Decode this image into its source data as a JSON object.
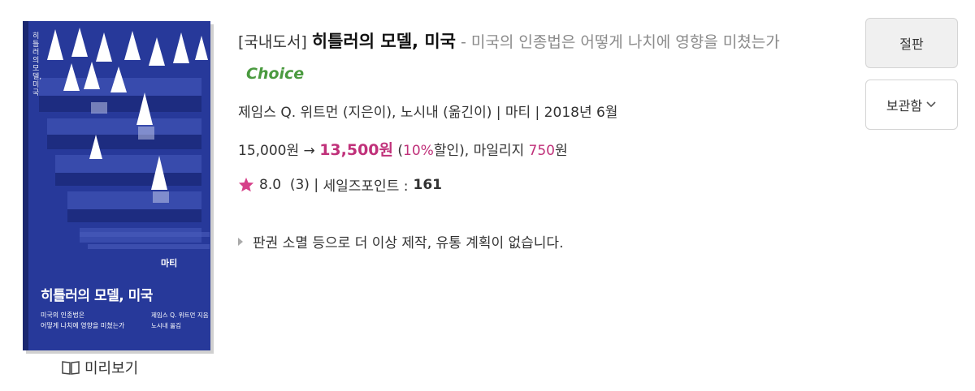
{
  "book": {
    "category": "[국내도서]",
    "title": "히틀러의 모델, 미국",
    "subtitle": "- 미국의 인종법은 어떻게 나치에 영향을 미쳤는가",
    "badge": "Choice",
    "author_line": "제임스 Q. 위트먼 (지은이), 노시내 (옮긴이) | 마티 | 2018년 6월",
    "price": {
      "original": "15,000원",
      "arrow": "→",
      "sale": "13,500원",
      "discount_open": "(",
      "discount_pct": "10%",
      "discount_close": "할인), 마일리지 ",
      "mileage": "750",
      "mileage_unit": "원"
    },
    "rating": {
      "score": "8.0",
      "count": "(3)",
      "separator": "|",
      "points_label": "세일즈포인트 :",
      "points": "161"
    },
    "notice": "판권 소멸 등으로 더 이상 제작, 유통 계획이 없습니다."
  },
  "cover": {
    "spine_text": "히틀러의 모델, 미국",
    "publisher": "마티",
    "title": "히틀러의 모델, 미국",
    "subtitle_line1": "미국의 인종법은",
    "subtitle_line2": "어떻게 나치에 영향을 미쳤는가",
    "author_line1": "제임스 Q. 위트먼 지음",
    "author_line2": "노시내 옮김"
  },
  "preview": {
    "label": "미리보기",
    "icon": "book-open-icon"
  },
  "buttons": {
    "soldout": "절판",
    "save": "보관함",
    "save_icon": "chevron-down-icon"
  },
  "colors": {
    "cover_blue": "#27399a",
    "accent_pink": "#c0317a",
    "choice_green": "#4a9a3f",
    "star_pink": "#d6408a"
  }
}
